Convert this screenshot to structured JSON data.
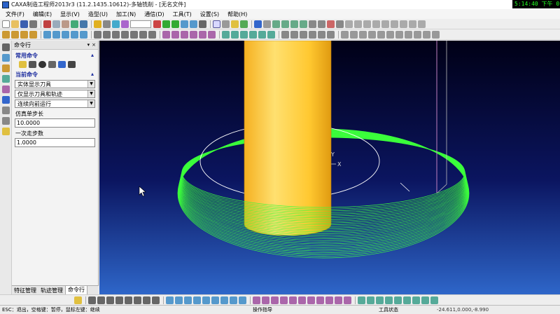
{
  "window": {
    "title": "CAXA制造工程师2013r3 (11.2.1435.10612)-多轴铣削 - [无名文件]",
    "clock": "5:14:40 下午 01/"
  },
  "menu": [
    "文件(F)",
    "编辑(E)",
    "显示(V)",
    "造型(U)",
    "加工(N)",
    "通信(D)",
    "工具(T)",
    "设置(S)",
    "帮助(H)"
  ],
  "panel": {
    "title": "命令行",
    "pin": "▾",
    "close": "×",
    "common_section": "常用命令",
    "current_section": "当前命令",
    "combo1": "实体显示刀具",
    "combo2": "仅显示刀具和轨迹",
    "combo3": "连续向前运行",
    "step_label": "仿真单步长",
    "step_value": "10.0000",
    "count_label": "一次走步数",
    "count_value": "1.0000",
    "tabs": [
      "特征管理",
      "轨迹管理",
      "命令行"
    ]
  },
  "viewport": {
    "axis_y": "Y",
    "axis_x": "X",
    "colors": {
      "tool": "#ffc830",
      "toolpath": "#3cff3c",
      "circle": "#ffffff"
    }
  },
  "status": {
    "hint": "ESC：退出，空格键：暂停，鼠标左键：继续",
    "center": "操作指导",
    "mode": "工具状态",
    "coords": "-24.611,0.000,-8.990"
  }
}
